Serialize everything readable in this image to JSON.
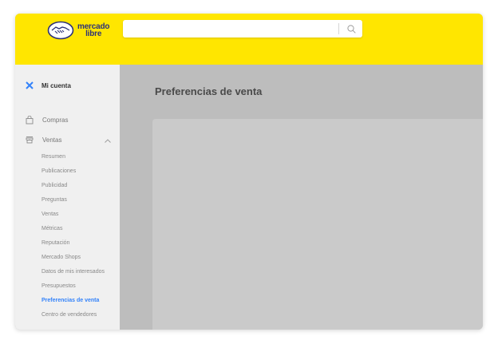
{
  "header": {
    "logo_line1": "mercado",
    "logo_line2": "libre",
    "search_placeholder": "",
    "bg_color": "#ffe600"
  },
  "sidebar": {
    "account_title": "Mi cuenta",
    "close_icon": "close-icon",
    "nav": [
      {
        "label": "Compras",
        "icon": "bag-icon"
      },
      {
        "label": "Ventas",
        "icon": "store-icon",
        "expanded": true
      }
    ],
    "sub_items": [
      {
        "label": "Resumen"
      },
      {
        "label": "Publicaciones"
      },
      {
        "label": "Publicidad"
      },
      {
        "label": "Preguntas"
      },
      {
        "label": "Ventas"
      },
      {
        "label": "Métricas"
      },
      {
        "label": "Reputación"
      },
      {
        "label": "Mercado Shops"
      },
      {
        "label": "Datos de mis interesados"
      },
      {
        "label": "Presupuestos"
      },
      {
        "label": "Preferencias de venta",
        "active": true
      },
      {
        "label": "Centro de vendedores"
      }
    ],
    "accent_color": "#3483fa"
  },
  "main": {
    "title": "Preferencias de venta"
  }
}
